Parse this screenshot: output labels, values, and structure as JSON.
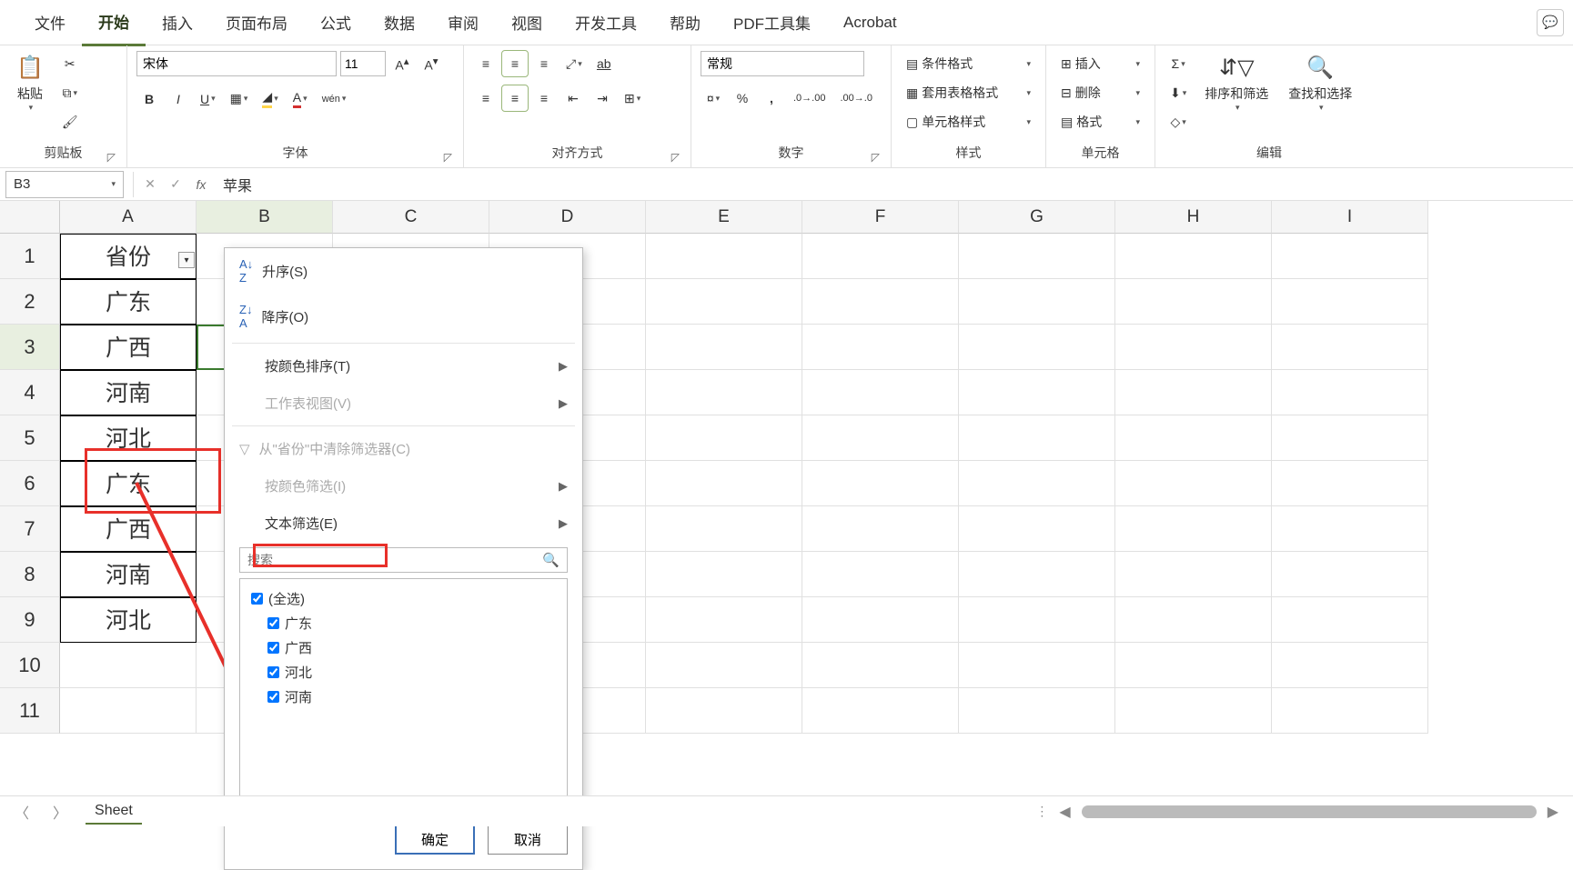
{
  "tabs": {
    "items": [
      "文件",
      "开始",
      "插入",
      "页面布局",
      "公式",
      "数据",
      "审阅",
      "视图",
      "开发工具",
      "帮助",
      "PDF工具集",
      "Acrobat"
    ],
    "active_index": 1
  },
  "ribbon": {
    "clipboard": {
      "paste": "粘贴",
      "group": "剪贴板"
    },
    "font": {
      "name": "宋体",
      "size": "11",
      "group": "字体",
      "phonetic": "wén"
    },
    "align": {
      "group": "对齐方式",
      "wrap": "ab",
      "merge": ""
    },
    "number": {
      "format": "常规",
      "group": "数字"
    },
    "styles": {
      "cond": "条件格式",
      "tbl": "套用表格格式",
      "cell": "单元格样式",
      "group": "样式"
    },
    "cells": {
      "ins": "插入",
      "del": "删除",
      "fmt": "格式",
      "group": "单元格"
    },
    "editing": {
      "sortfilter": "排序和筛选",
      "findselect": "查找和选择",
      "group": "编辑"
    }
  },
  "fbar": {
    "name": "B3",
    "formula": "苹果"
  },
  "columns": [
    "A",
    "B",
    "C",
    "D",
    "E",
    "F",
    "G",
    "H",
    "I"
  ],
  "rows": [
    "1",
    "2",
    "3",
    "4",
    "5",
    "6",
    "7",
    "8",
    "9",
    "10",
    "11"
  ],
  "col_a_data": [
    "省份",
    "广东",
    "广西",
    "河南",
    "河北",
    "广东",
    "广西",
    "河南",
    "河北"
  ],
  "selected_cell": "B3",
  "filter": {
    "asc": "升序(S)",
    "desc": "降序(O)",
    "by_color_sort": "按颜色排序(T)",
    "sheet_view": "工作表视图(V)",
    "clear": "从\"省份\"中清除筛选器(C)",
    "by_color_filter": "按颜色筛选(I)",
    "text_filter": "文本筛选(E)",
    "search_placeholder": "搜索",
    "select_all": "(全选)",
    "items": [
      "广东",
      "广西",
      "河北",
      "河南"
    ],
    "ok": "确定",
    "cancel": "取消"
  },
  "sheet_tab": "Sheet",
  "icons": {
    "sort_az": "A↓Z",
    "sort_za": "Z↓A"
  }
}
